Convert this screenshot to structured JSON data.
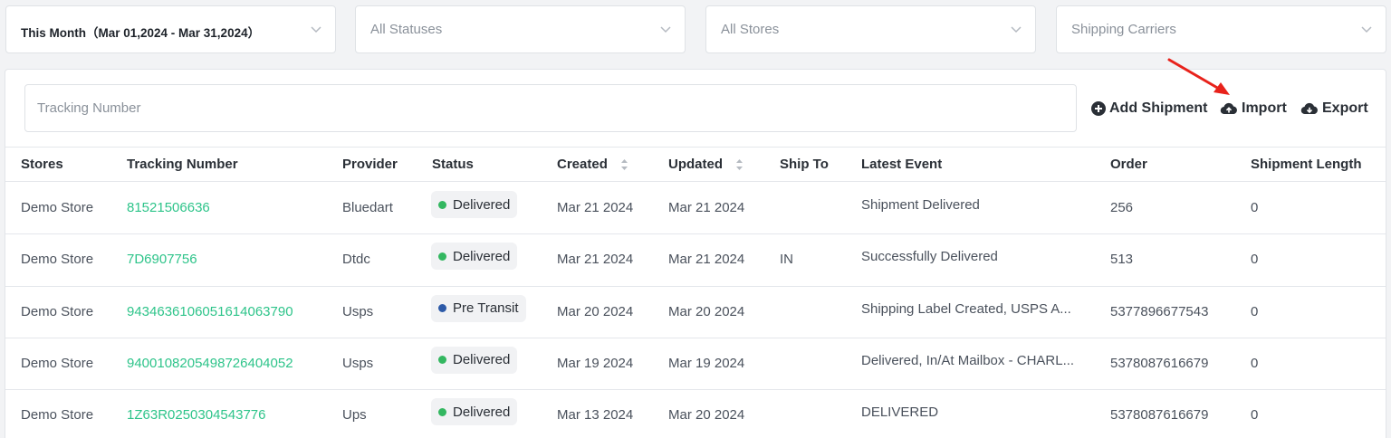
{
  "filters": {
    "date_range": "This Month（Mar 01,2024 - Mar 31,2024）",
    "status": "All Statuses",
    "stores": "All Stores",
    "carriers": "Shipping Carriers"
  },
  "search": {
    "placeholder": "Tracking Number"
  },
  "actions": {
    "add_shipment": "Add Shipment",
    "import": "Import",
    "export": "Export"
  },
  "annotation": {
    "arrow_color": "#e8221b",
    "points_to": "import"
  },
  "table": {
    "columns": [
      "Stores",
      "Tracking Number",
      "Provider",
      "Status",
      "Created",
      "Updated",
      "Ship To",
      "Latest Event",
      "Order",
      "Shipment Length"
    ],
    "rows": [
      {
        "store": "Demo Store",
        "tracking": "81521506636",
        "provider": "Bluedart",
        "status": "Delivered",
        "status_color": "#33b760",
        "created": "Mar 21 2024",
        "updated": "Mar 21 2024",
        "ship_to": "",
        "event": "Shipment Delivered",
        "order": "256",
        "length": "0"
      },
      {
        "store": "Demo Store",
        "tracking": "7D6907756",
        "provider": "Dtdc",
        "status": "Delivered",
        "status_color": "#33b760",
        "created": "Mar 21 2024",
        "updated": "Mar 21 2024",
        "ship_to": "IN",
        "event": "Successfully Delivered",
        "order": "513",
        "length": "0"
      },
      {
        "store": "Demo Store",
        "tracking": "9434636106051614063790",
        "provider": "Usps",
        "status": "Pre Transit",
        "status_color": "#2d5aa8",
        "created": "Mar 20 2024",
        "updated": "Mar 20 2024",
        "ship_to": "",
        "event": "Shipping Label Created, USPS A...",
        "order": "5377896677543",
        "length": "0"
      },
      {
        "store": "Demo Store",
        "tracking": "9400108205498726404052",
        "provider": "Usps",
        "status": "Delivered",
        "status_color": "#33b760",
        "created": "Mar 19 2024",
        "updated": "Mar 19 2024",
        "ship_to": "",
        "event": "Delivered, In/At Mailbox - CHARL...",
        "order": "5378087616679",
        "length": "0"
      },
      {
        "store": "Demo Store",
        "tracking": "1Z63R0250304543776",
        "provider": "Ups",
        "status": "Delivered",
        "status_color": "#33b760",
        "created": "Mar 13 2024",
        "updated": "Mar 20 2024",
        "ship_to": "",
        "event": "DELIVERED",
        "order": "5378087616679",
        "length": "0"
      }
    ]
  }
}
